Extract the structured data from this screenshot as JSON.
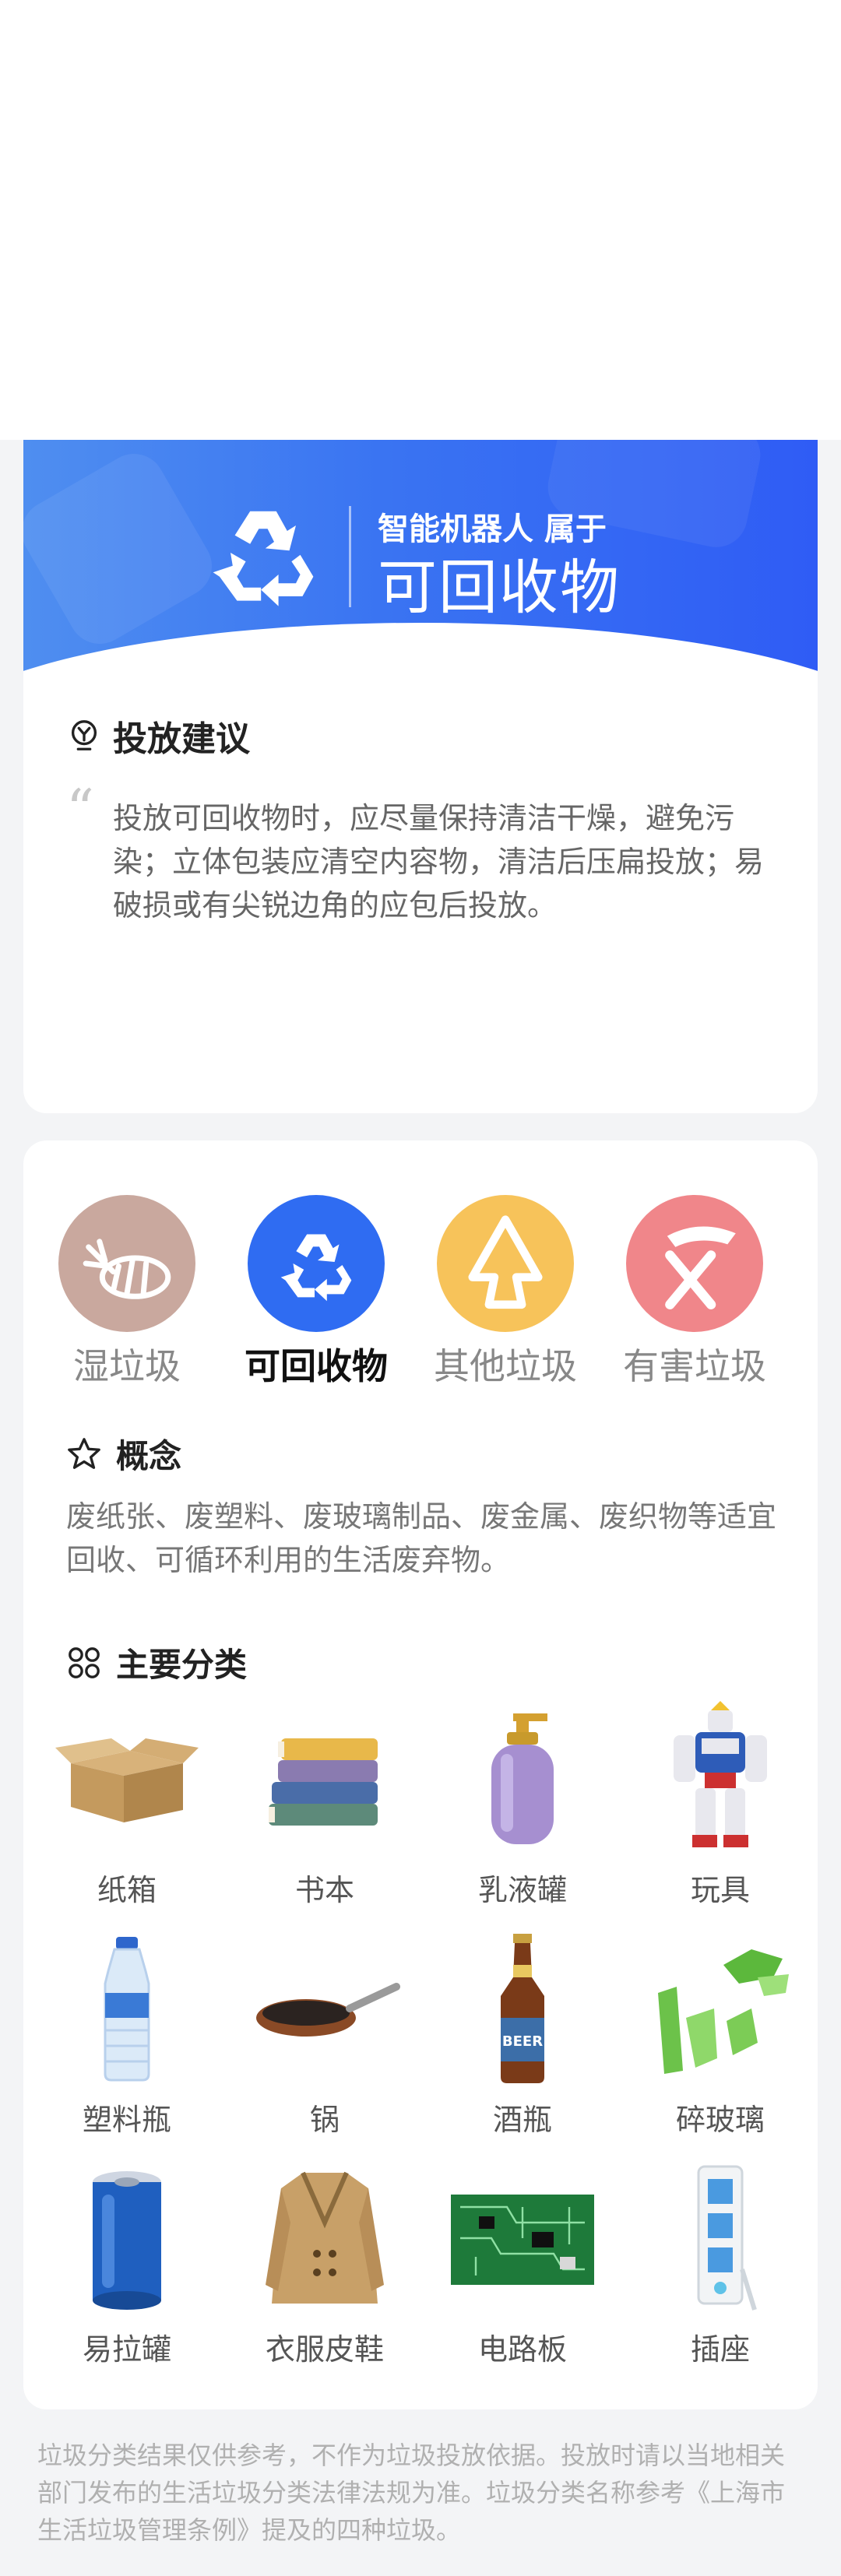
{
  "result": {
    "subtitle": "智能机器人 属于",
    "category": "可回收物",
    "icon": "recycle-icon",
    "advice_title": "投放建议",
    "advice_icon": "lightbulb-icon",
    "advice_text": "投放可回收物时，应尽量保持清洁干燥，避免污染；立体包装应清空内容物，清洁后压扁投放；易破损或有尖锐边角的应包后投放。",
    "colors": {
      "banner_start": "#4f8ef0",
      "banner_end": "#2f5cf5"
    }
  },
  "tabs": [
    {
      "label": "湿垃圾",
      "icon": "fish-bone-icon",
      "color": "#c9a89e",
      "active": false
    },
    {
      "label": "可回收物",
      "icon": "recycle-icon",
      "color": "#2f6cf2",
      "active": true
    },
    {
      "label": "其他垃圾",
      "icon": "tree-icon",
      "color": "#f7c35a",
      "active": false
    },
    {
      "label": "有害垃圾",
      "icon": "battery-cross-icon",
      "color": "#f0868a",
      "active": false
    }
  ],
  "concept": {
    "title": "概念",
    "icon": "star-icon",
    "text": "废纸张、废塑料、废玻璃制品、废金属、废织物等适宜回收、可循环利用的生活废弃物。"
  },
  "main_types": {
    "title": "主要分类",
    "icon": "grid-icon",
    "items": [
      {
        "label": "纸箱",
        "icon": "cardboard-box-icon"
      },
      {
        "label": "书本",
        "icon": "books-icon"
      },
      {
        "label": "乳液罐",
        "icon": "lotion-bottle-icon"
      },
      {
        "label": "玩具",
        "icon": "robot-toy-icon"
      },
      {
        "label": "塑料瓶",
        "icon": "plastic-bottle-icon"
      },
      {
        "label": "锅",
        "icon": "frying-pan-icon"
      },
      {
        "label": "酒瓶",
        "icon": "beer-bottle-icon"
      },
      {
        "label": "碎玻璃",
        "icon": "broken-glass-icon"
      },
      {
        "label": "易拉罐",
        "icon": "soda-can-icon"
      },
      {
        "label": "衣服皮鞋",
        "icon": "jacket-icon"
      },
      {
        "label": "电路板",
        "icon": "circuit-board-icon"
      },
      {
        "label": "插座",
        "icon": "power-strip-icon"
      }
    ]
  },
  "disclaimer": "垃圾分类结果仅供参考，不作为垃圾投放依据。投放时请以当地相关部门发布的生活垃圾分类法律法规为准。垃圾分类名称参考《上海市生活垃圾管理条例》提及的四种垃圾。"
}
